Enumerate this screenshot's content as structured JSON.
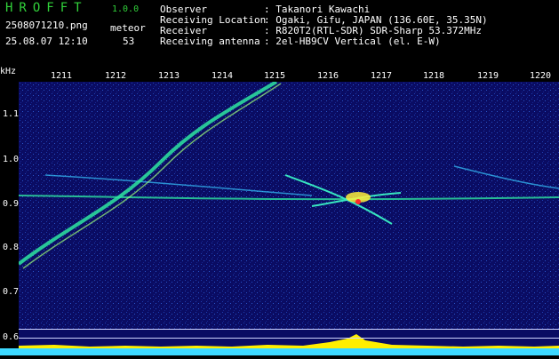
{
  "app": {
    "logo": "HROFFT",
    "version": "1.0.0"
  },
  "file": {
    "name": "2508071210.png",
    "datetime": "25.08.07 12:10"
  },
  "meteor": {
    "label": "meteor",
    "count": "53"
  },
  "info": [
    {
      "key": "Observer",
      "value": ": Takanori Kawachi"
    },
    {
      "key": "Receiving Location",
      "value": ": Ogaki, Gifu, JAPAN (136.60E, 35.35N)"
    },
    {
      "key": "Receiver",
      "value": ": R820T2(RTL-SDR) SDR-Sharp 53.372MHz"
    },
    {
      "key": "Receiving antenna",
      "value": ": 2el-HB9CV Vertical (el. E-W)"
    }
  ],
  "axis": {
    "unit": "kHz",
    "x_ticks": [
      "1211",
      "1212",
      "1213",
      "1214",
      "1215",
      "1216",
      "1217",
      "1218",
      "1219",
      "1220"
    ],
    "y_ticks": [
      "1.1",
      "1.0",
      "0.9",
      "0.8",
      "0.7",
      "0.6"
    ]
  },
  "colors": {
    "background": "#0a0c63",
    "signal": "#2ee6a0",
    "hot": "#ffef3a",
    "core": "#ff2a2a",
    "level_fill": "#ffee00"
  }
}
